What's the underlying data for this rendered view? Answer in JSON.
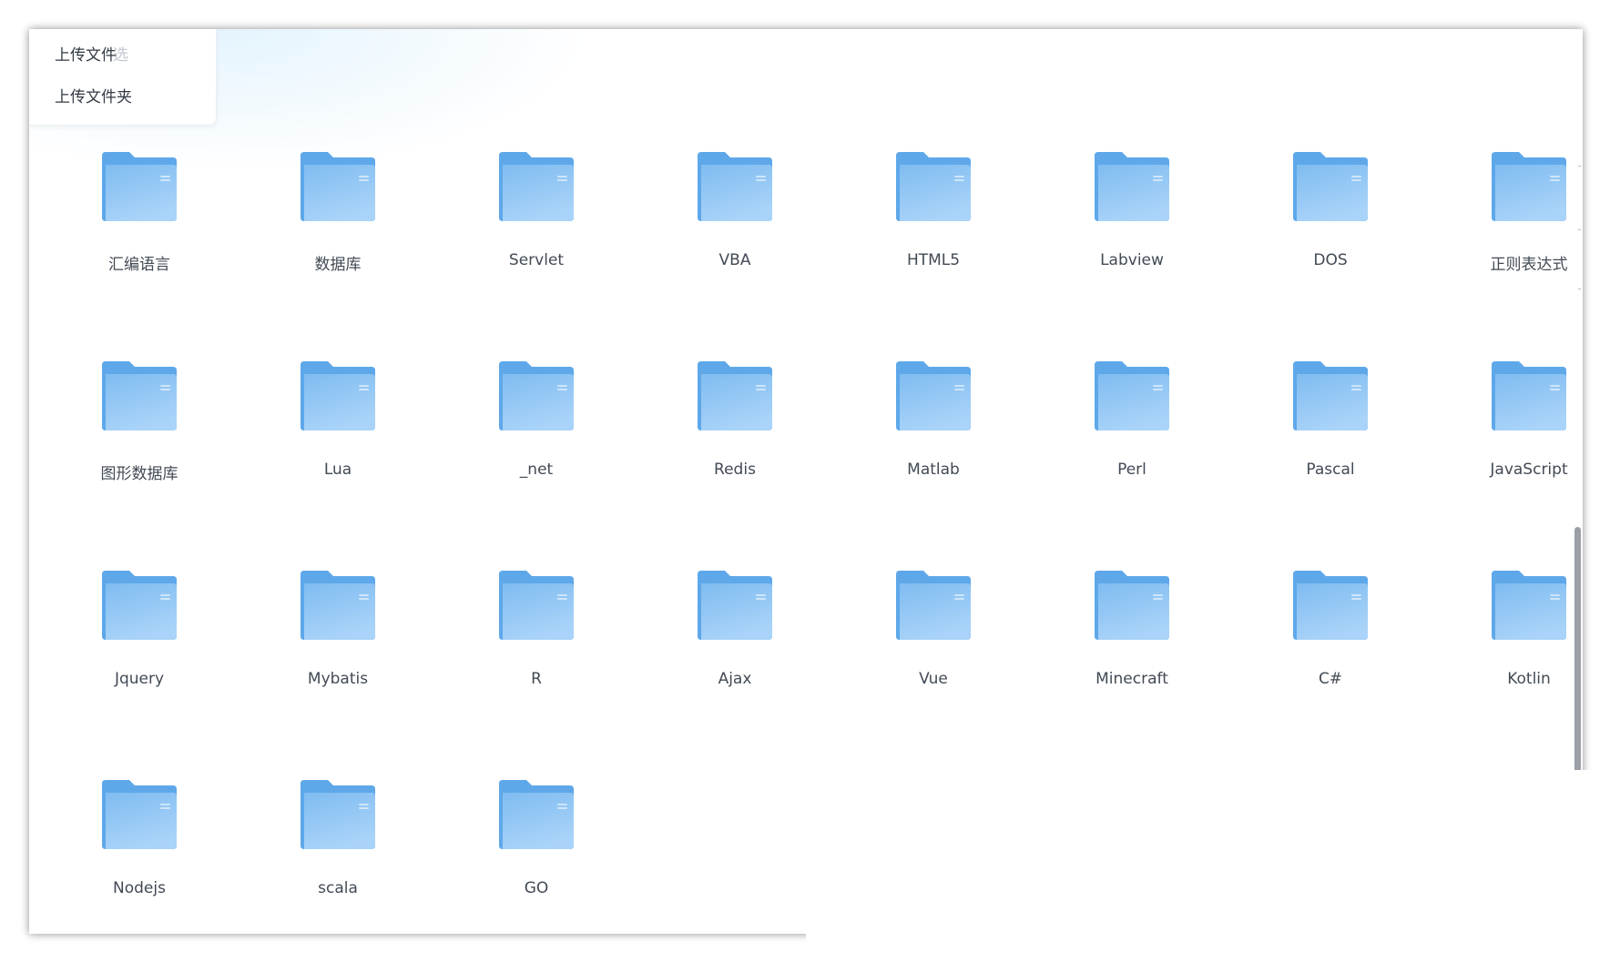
{
  "upload_menu": {
    "upload_file": "上传文件",
    "upload_folder": "上传文件夹",
    "ghost_filter": "选"
  },
  "folders": [
    {
      "label": "汇编语言"
    },
    {
      "label": "数据库"
    },
    {
      "label": "Servlet"
    },
    {
      "label": "VBA"
    },
    {
      "label": "HTML5"
    },
    {
      "label": "Labview"
    },
    {
      "label": "DOS"
    },
    {
      "label": "正则表达式"
    },
    {
      "label": "图形数据库"
    },
    {
      "label": "Lua"
    },
    {
      "label": "_net"
    },
    {
      "label": "Redis"
    },
    {
      "label": "Matlab"
    },
    {
      "label": "Perl"
    },
    {
      "label": "Pascal"
    },
    {
      "label": "JavaScript"
    },
    {
      "label": "Jquery"
    },
    {
      "label": "Mybatis"
    },
    {
      "label": "R"
    },
    {
      "label": "Ajax"
    },
    {
      "label": "Vue"
    },
    {
      "label": "Minecraft"
    },
    {
      "label": "C#"
    },
    {
      "label": "Kotlin"
    },
    {
      "label": "Nodejs"
    },
    {
      "label": "scala"
    },
    {
      "label": "GO"
    }
  ],
  "icons": {
    "folder": "folder-icon"
  },
  "colors": {
    "folder_back": "#5ea8ea",
    "folder_front_top": "#7fbcf1",
    "folder_front_bottom": "#a9d3f8",
    "label_text": "#424a55",
    "scrollbar": "#9aa0a6"
  }
}
